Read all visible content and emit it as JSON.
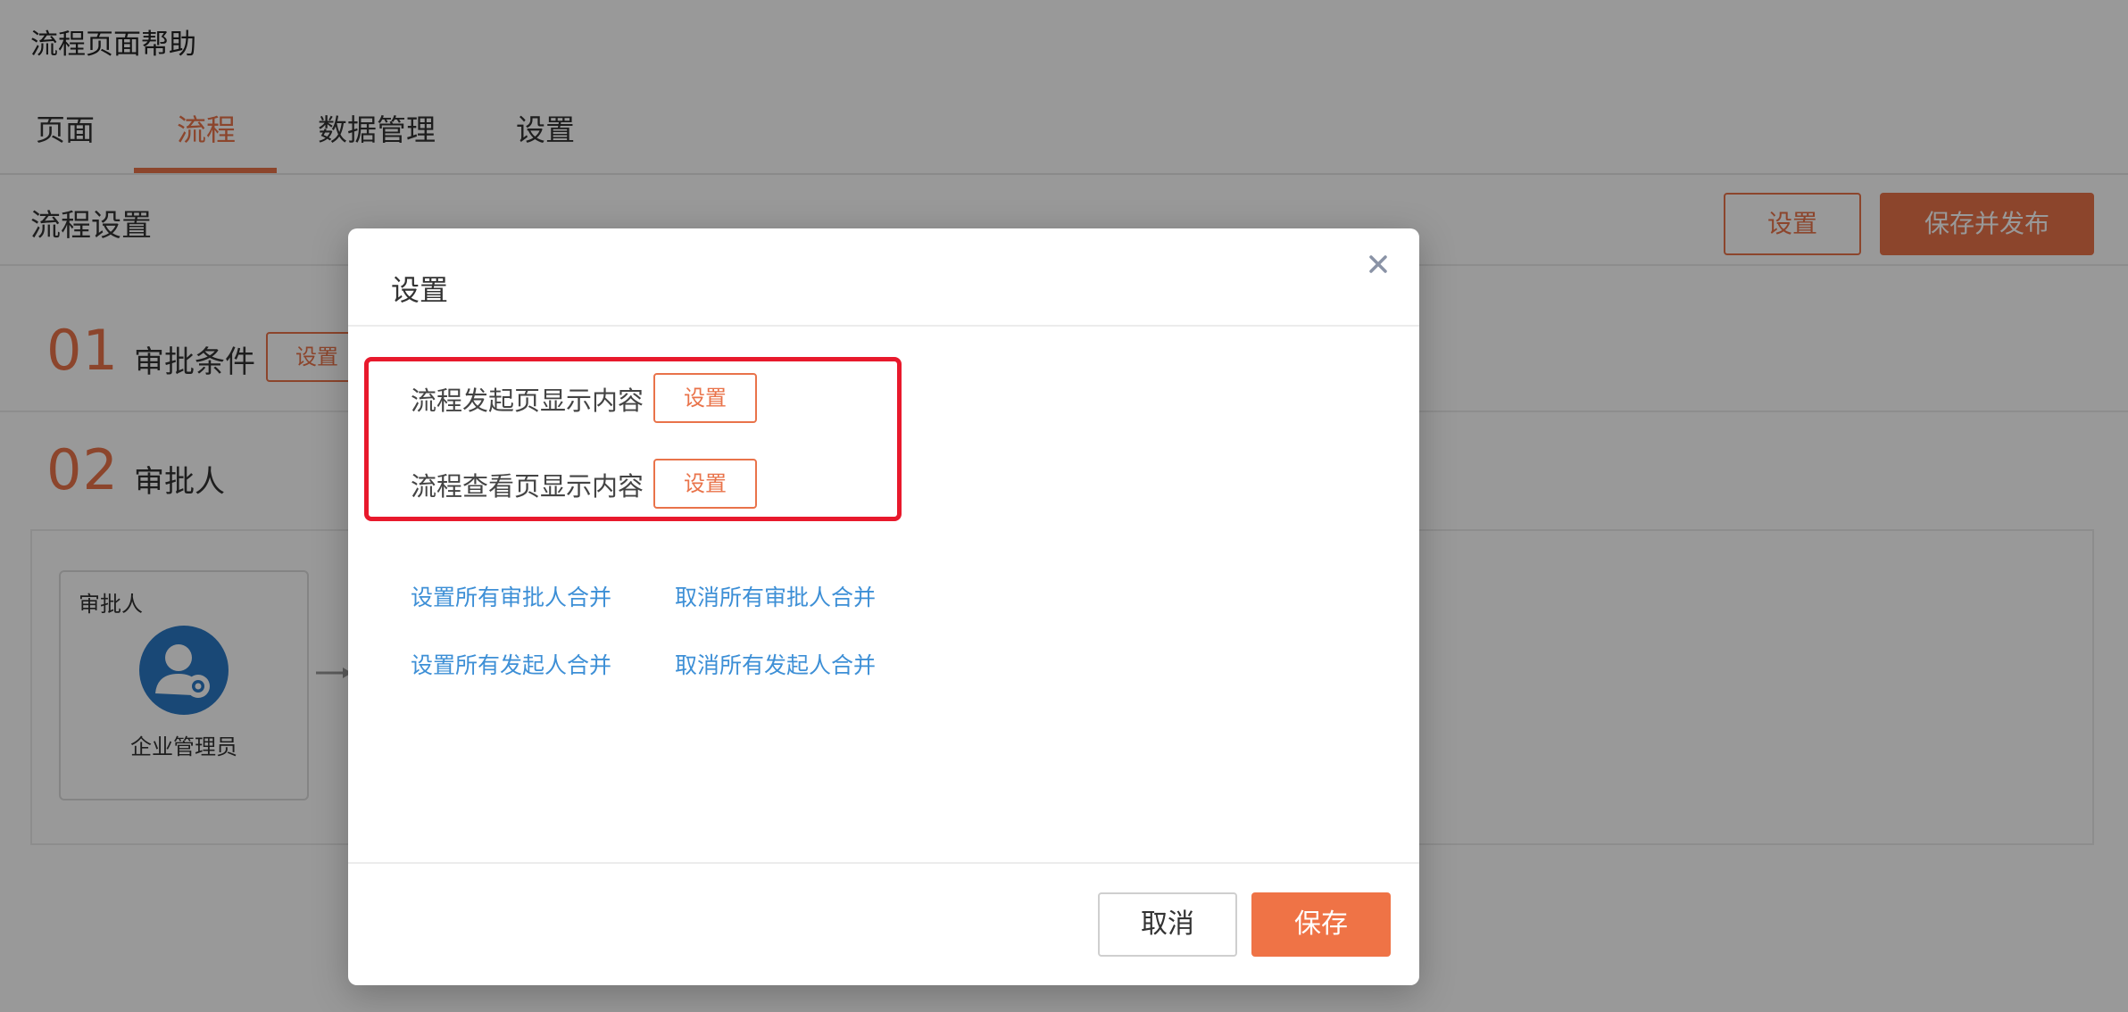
{
  "app": {
    "title": "流程页面帮助"
  },
  "tabs": [
    {
      "label": "页面"
    },
    {
      "label": "流程"
    },
    {
      "label": "数据管理"
    },
    {
      "label": "设置"
    }
  ],
  "section": {
    "title": "流程设置",
    "settings_label": "设置",
    "publish_label": "保存并发布"
  },
  "steps": [
    {
      "number": "01",
      "label": "审批条件",
      "button_label": "设置"
    },
    {
      "number": "02",
      "label": "审批人"
    }
  ],
  "approver_card": {
    "title": "审批人",
    "name": "企业管理员"
  },
  "modal": {
    "title": "设置",
    "rows": [
      {
        "label": "流程发起页显示内容",
        "button_label": "设置"
      },
      {
        "label": "流程查看页显示内容",
        "button_label": "设置"
      }
    ],
    "links": [
      "设置所有审批人合并",
      "取消所有审批人合并",
      "设置所有发起人合并",
      "取消所有发起人合并"
    ],
    "cancel_label": "取消",
    "save_label": "保存"
  },
  "colors": {
    "accent": "#e9734a",
    "highlight": "#e8192c",
    "link": "#3d8fd6",
    "avatar": "#2b78c5"
  }
}
